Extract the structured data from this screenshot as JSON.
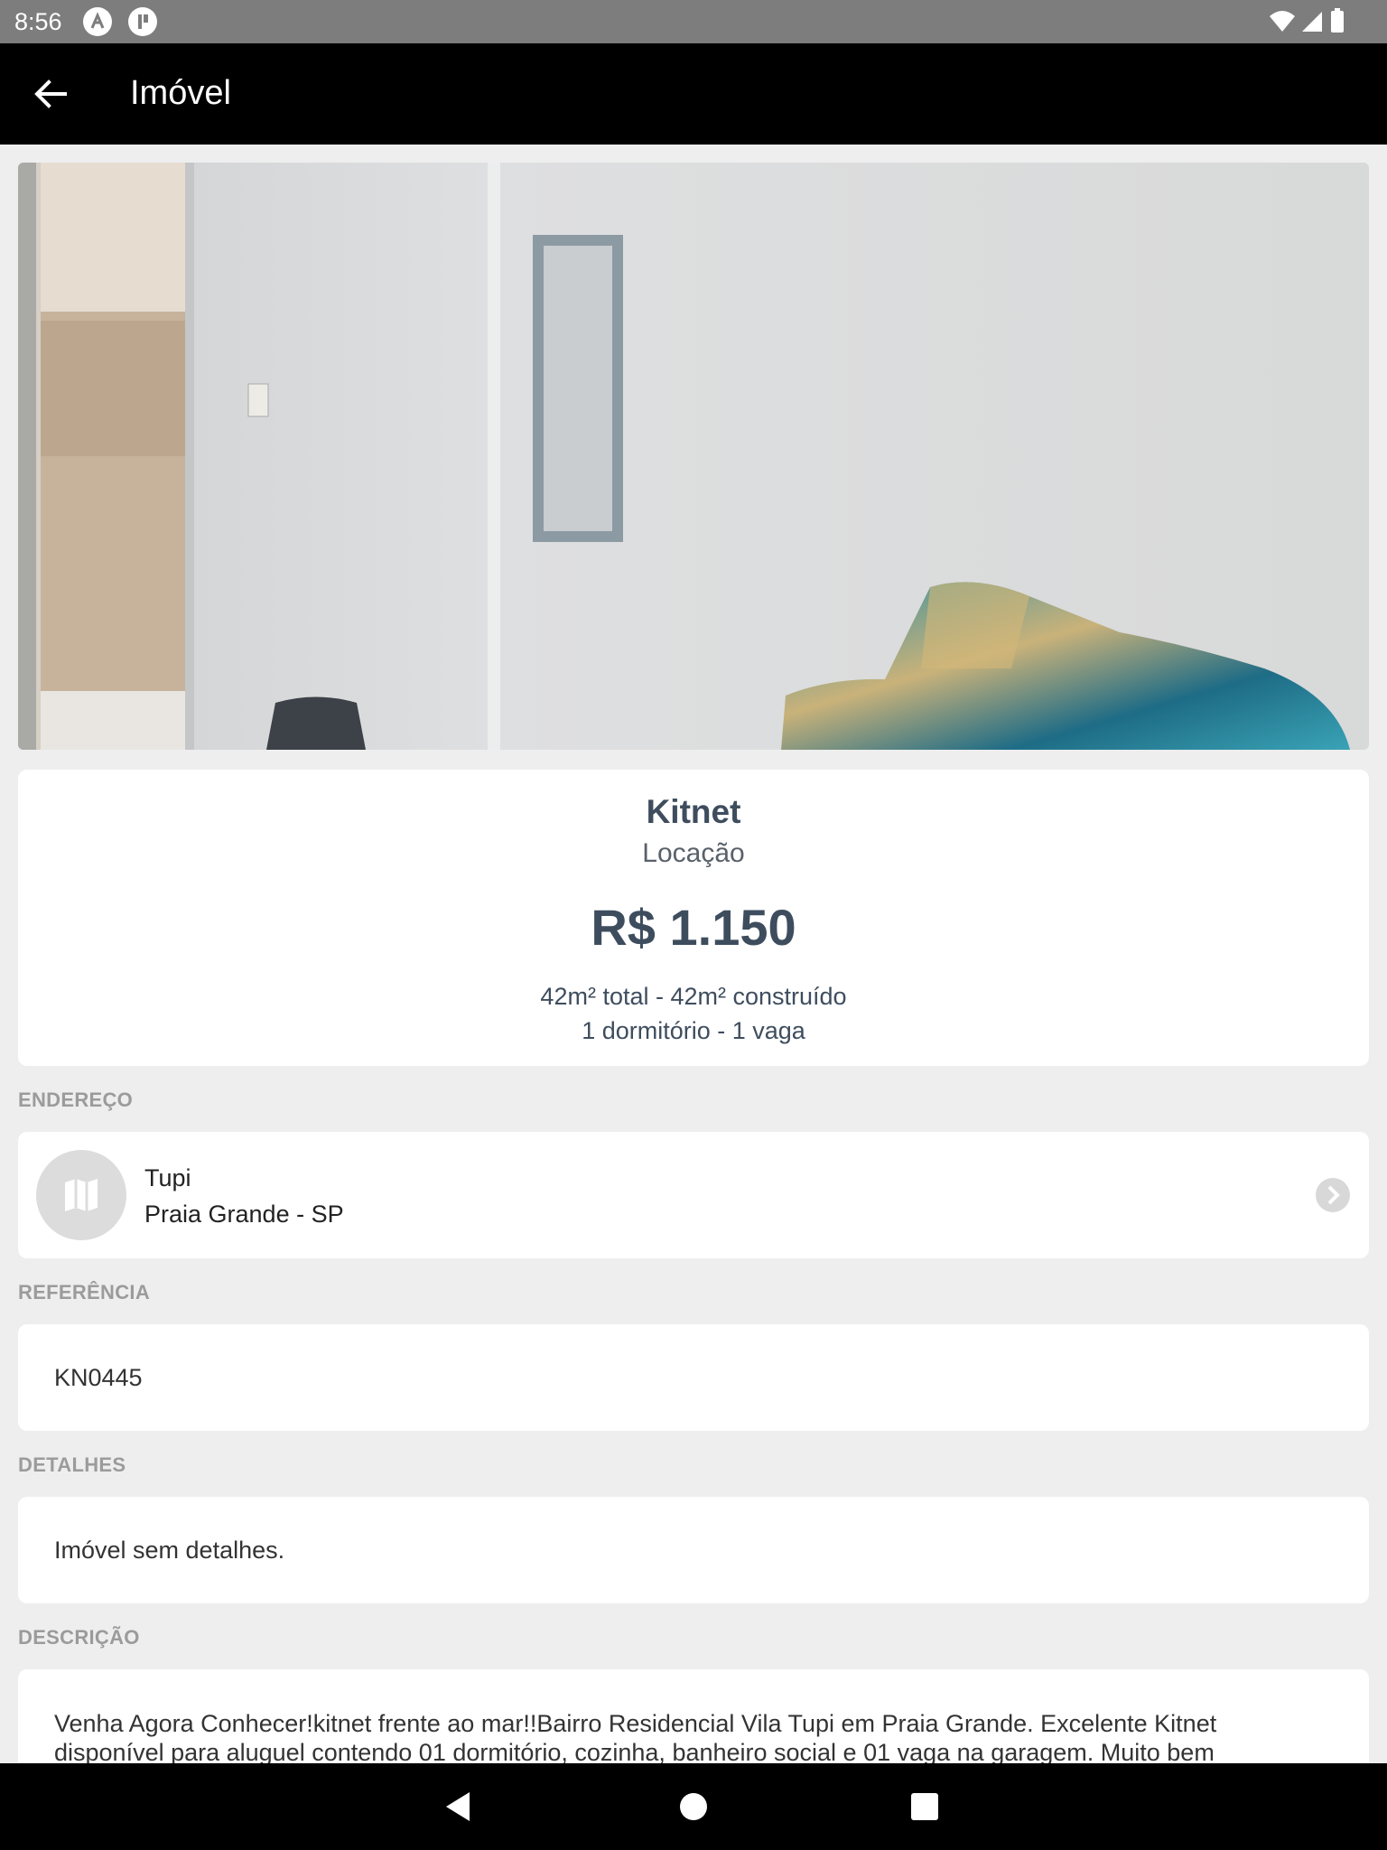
{
  "status_bar": {
    "time": "8:56"
  },
  "app_bar": {
    "title": "Imóvel"
  },
  "property": {
    "type": "Kitnet",
    "deal": "Locação",
    "price": "R$ 1.150",
    "area": "42m² total - 42m² construído",
    "rooms": "1 dormitório - 1 vaga"
  },
  "sections": {
    "address": {
      "label": "ENDEREÇO",
      "neighborhood": "Tupi",
      "city": "Praia Grande - SP"
    },
    "reference": {
      "label": "REFERÊNCIA",
      "value": "KN0445"
    },
    "details": {
      "label": "DETALHES",
      "value": "Imóvel sem detalhes."
    },
    "description": {
      "label": "DESCRIÇÃO",
      "value": "Venha Agora Conhecer!kitnet frente ao mar!!Bairro Residencial Vila Tupi em Praia Grande. Excelente Kitnet disponível para aluguel contendo  01 dormitório, cozinha, banheiro social e 01 vaga na garagem. Muito bem"
    }
  },
  "icons": {
    "back": "arrow-left-icon",
    "map": "map-icon",
    "chevron": "chevron-right-circle-icon",
    "nav_back": "triangle-back-icon",
    "nav_home": "circle-home-icon",
    "nav_recents": "square-recents-icon"
  },
  "colors": {
    "app_bar": "#000000",
    "background": "#eeeeee",
    "text_primary": "#3e4d5e",
    "section_label": "#9b9b9b"
  }
}
